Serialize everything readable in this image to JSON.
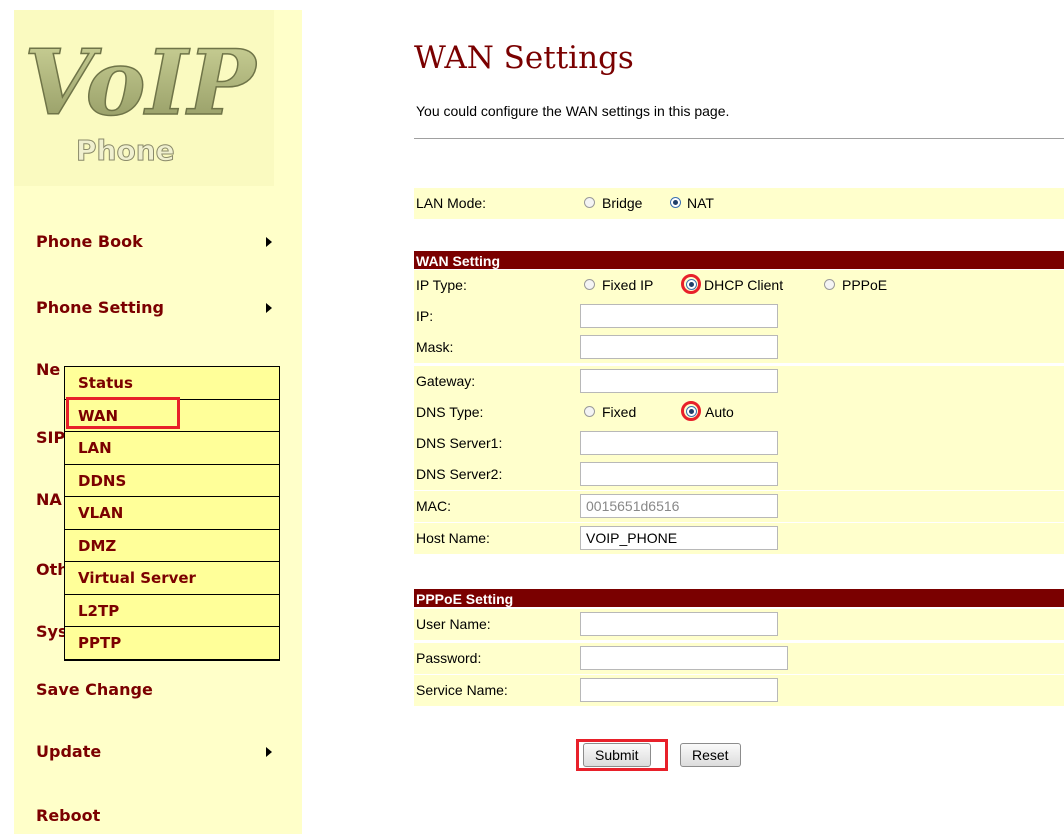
{
  "logo": {
    "title": "VoIP",
    "subtitle": "Phone"
  },
  "sidebar": {
    "items": [
      {
        "label": "Phone Book"
      },
      {
        "label": "Phone Setting"
      },
      {
        "label": "Ne"
      },
      {
        "label": "SIP"
      },
      {
        "label": "NA"
      },
      {
        "label": "Oth"
      },
      {
        "label": "Sys"
      },
      {
        "label": "Save Change"
      },
      {
        "label": "Update"
      },
      {
        "label": "Reboot"
      }
    ],
    "submenu": [
      "Status",
      "WAN",
      "LAN",
      "DDNS",
      "VLAN",
      "DMZ",
      "Virtual Server",
      "L2TP",
      "PPTP"
    ]
  },
  "page": {
    "title": "WAN Settings",
    "description": "You could configure the WAN settings in this page."
  },
  "lan_mode": {
    "label": "LAN Mode:",
    "options": [
      "Bridge",
      "NAT"
    ],
    "selected": "NAT"
  },
  "wan_setting": {
    "header": "WAN Setting",
    "ip_type": {
      "label": "IP Type:",
      "options": [
        "Fixed IP",
        "DHCP Client",
        "PPPoE"
      ],
      "selected": "DHCP Client"
    },
    "ip": {
      "label": "IP:",
      "value": ""
    },
    "mask": {
      "label": "Mask:",
      "value": ""
    },
    "gateway": {
      "label": "Gateway:",
      "value": ""
    },
    "dns_type": {
      "label": "DNS Type:",
      "options": [
        "Fixed",
        "Auto"
      ],
      "selected": "Auto"
    },
    "dns1": {
      "label": "DNS Server1:",
      "value": ""
    },
    "dns2": {
      "label": "DNS Server2:",
      "value": ""
    },
    "mac": {
      "label": "MAC:",
      "value": "0015651d6516"
    },
    "host_name": {
      "label": "Host Name:",
      "value": "VOIP_PHONE"
    }
  },
  "pppoe_setting": {
    "header": "PPPoE Setting",
    "user_name": {
      "label": "User Name:",
      "value": ""
    },
    "password": {
      "label": "Password:",
      "value": ""
    },
    "service_name": {
      "label": "Service Name:",
      "value": ""
    }
  },
  "buttons": {
    "submit": "Submit",
    "reset": "Reset"
  },
  "colors": {
    "sidebar_bg": "#ffffc9",
    "accent": "#7a0000",
    "row_bg": "#ffffcc",
    "highlight": "#e8202a"
  }
}
